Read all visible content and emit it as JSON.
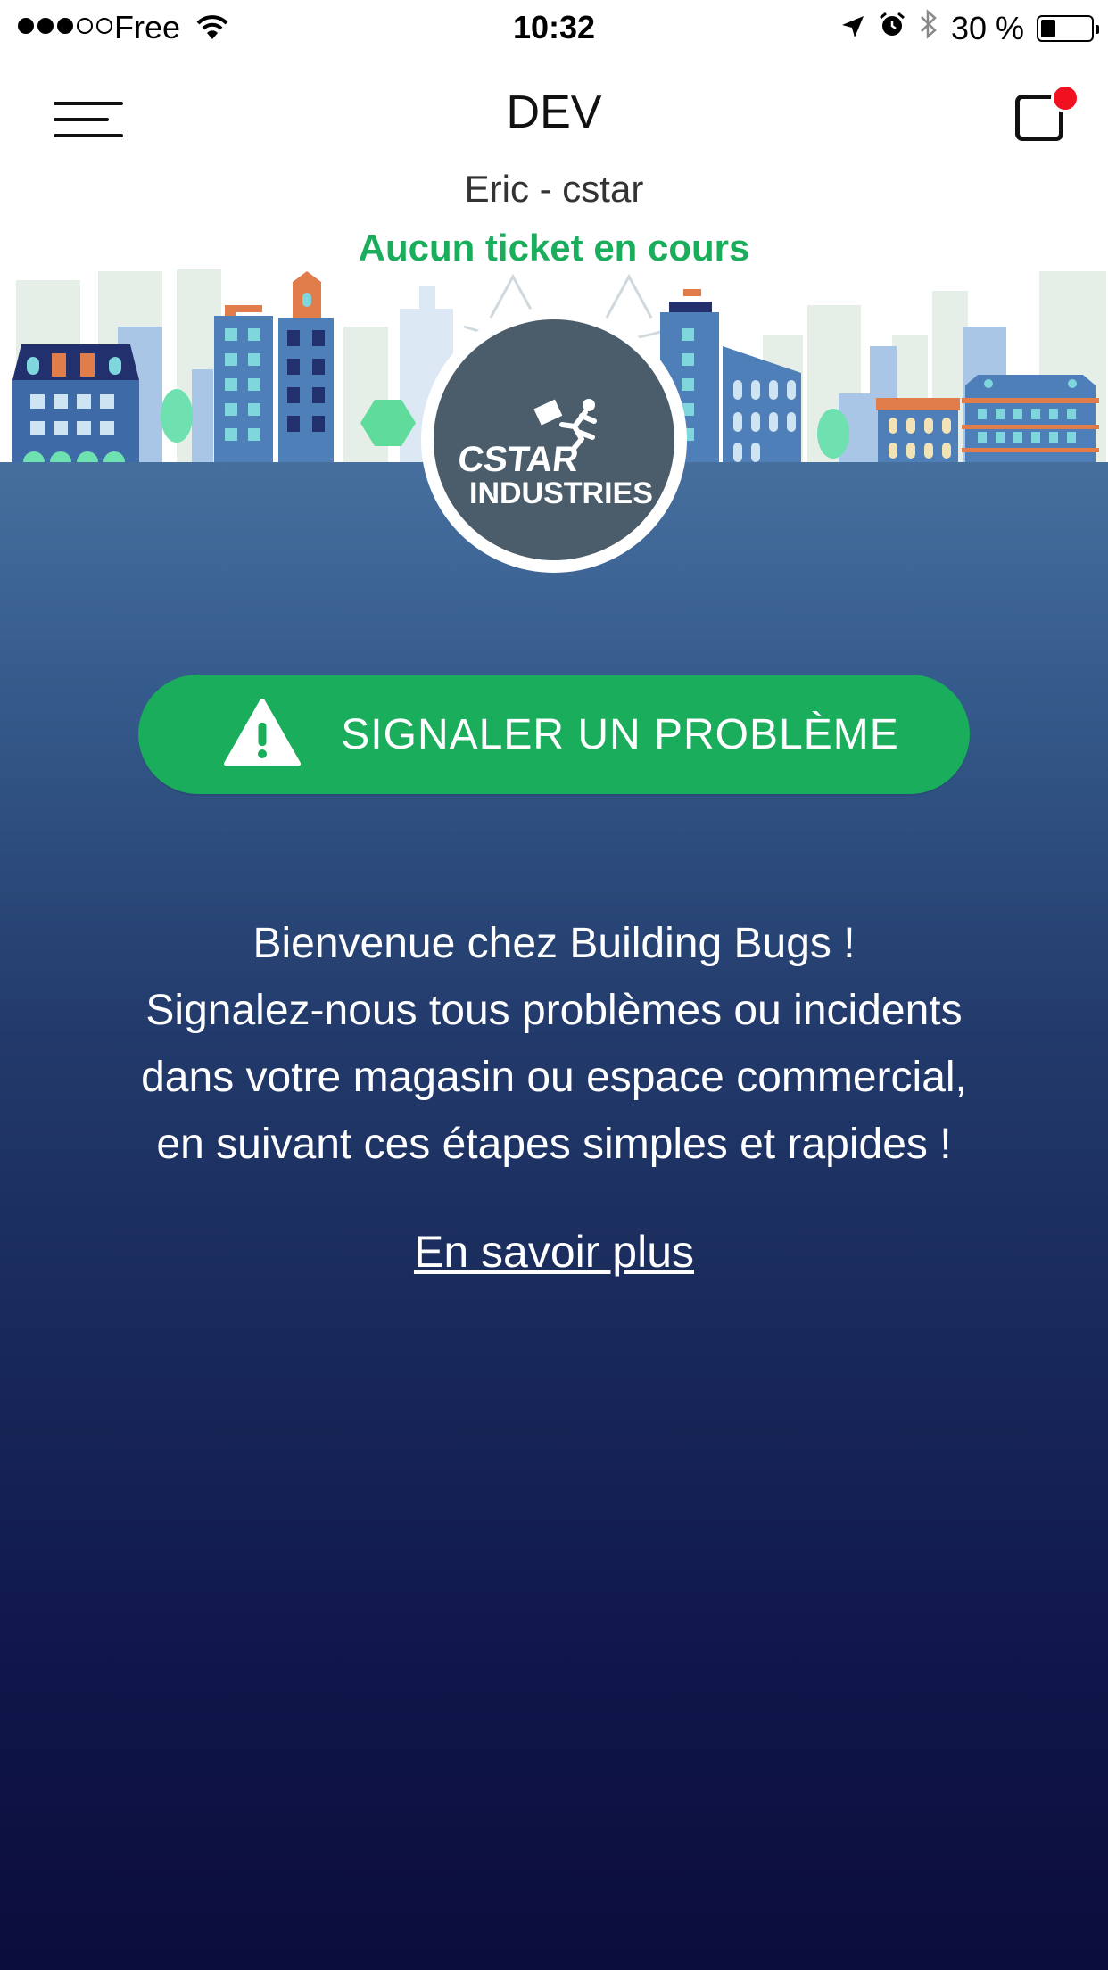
{
  "status_bar": {
    "carrier": "Free",
    "time": "10:32",
    "battery_percent": "30 %",
    "battery_level": 0.3,
    "signal_bars_filled": 3,
    "signal_bars_total": 5
  },
  "header": {
    "title": "DEV",
    "user": "Eric - cstar",
    "ticket_status": "Aucun ticket en cours"
  },
  "logo": {
    "line1": "CSTAR",
    "line2": "INDUSTRIES"
  },
  "actions": {
    "report_label": "SIGNALER UN PROBLÈME"
  },
  "welcome": {
    "lines": [
      "Bienvenue chez Building Bugs !",
      "Signalez-nous tous problèmes ou incidents",
      "dans votre magasin ou espace commercial,",
      "en suivant ces étapes simples et rapides !"
    ]
  },
  "learn_more": "En savoir plus",
  "colors": {
    "accent_green": "#1aad5b",
    "notification_red": "#f01020",
    "panel_top": "#466f9e",
    "panel_bottom": "#0b0d3c"
  },
  "icons": [
    "hamburger-menu-icon",
    "notification-icon",
    "warning-icon",
    "wifi-icon",
    "location-icon",
    "alarm-icon",
    "bluetooth-icon",
    "battery-icon"
  ]
}
